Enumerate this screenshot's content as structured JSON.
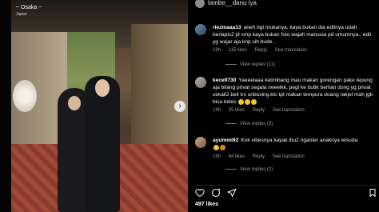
{
  "post": {
    "location_main": "~ Osaka ~",
    "location_sub": "Japan"
  },
  "caption": {
    "text": "lambe__danu iya"
  },
  "comments": [
    {
      "user": "riezmaaa13",
      "text": "aneh bgt mukanya, kaya bukan dia editnya udah berlapis2 jd smp kaya bukan foto wajah manusia pd umumnya.. edit yg wajar aja knp sih bude..",
      "time": "19h",
      "likes": "115 likes",
      "reply": "Reply",
      "translation": "See translation",
      "view_replies": "View replies (11)"
    },
    {
      "user": "kece9730",
      "text": "Yaeeelaaa ketimbang mau makan gorengan pake tepung aja bilang privat segala neeeikk, pegi ke butik berlian dong yg privat sekali2 beli trs unboxing.klo tpt makan tempura doang rakjel mah jgk bisa keles",
      "time": "19h",
      "likes": "55 likes",
      "reply": "Reply",
      "translation": "See translation",
      "view_replies": "View replies (3)"
    },
    {
      "user": "ayummi92",
      "text": "Kok vibesnya kayak ibu2 nganter anaknya wisuda",
      "time": "19h",
      "likes": "84 likes",
      "reply": "Reply",
      "translation": "See translation",
      "view_replies": "View replies (2)"
    }
  ],
  "footer": {
    "likes": "497 likes"
  },
  "icons": {
    "next": "chevron-right-icon",
    "like": "heart-icon",
    "comment": "comment-icon",
    "share": "share-icon",
    "save": "bookmark-icon"
  },
  "colors": {
    "background": "#000000",
    "text": "#f5f5f5",
    "muted": "#9a9a9a"
  }
}
